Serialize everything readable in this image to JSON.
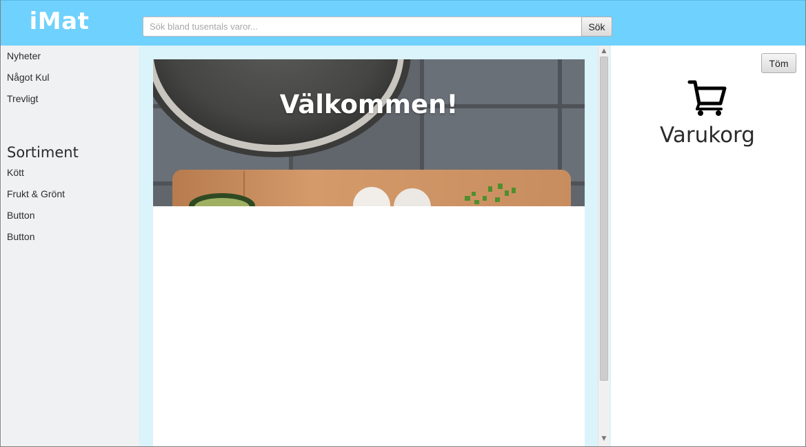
{
  "header": {
    "logo": "iMat",
    "search_placeholder": "Sök bland tusentals varor...",
    "search_button": "Sök"
  },
  "sidebar": {
    "top_items": [
      "Nyheter",
      "Något Kul",
      "Trevligt"
    ],
    "section_title": "Sortiment",
    "category_items": [
      "Kött",
      "Frukt & Grönt",
      "Button",
      "Button"
    ]
  },
  "main": {
    "hero_title": "Välkommen!"
  },
  "cart": {
    "clear_button": "Töm",
    "title": "Varukorg",
    "icon": "shopping-cart-icon"
  },
  "colors": {
    "header_bg": "#6fd1fd",
    "sidebar_bg": "#eff1f3",
    "content_bg": "#dbf3fb"
  }
}
